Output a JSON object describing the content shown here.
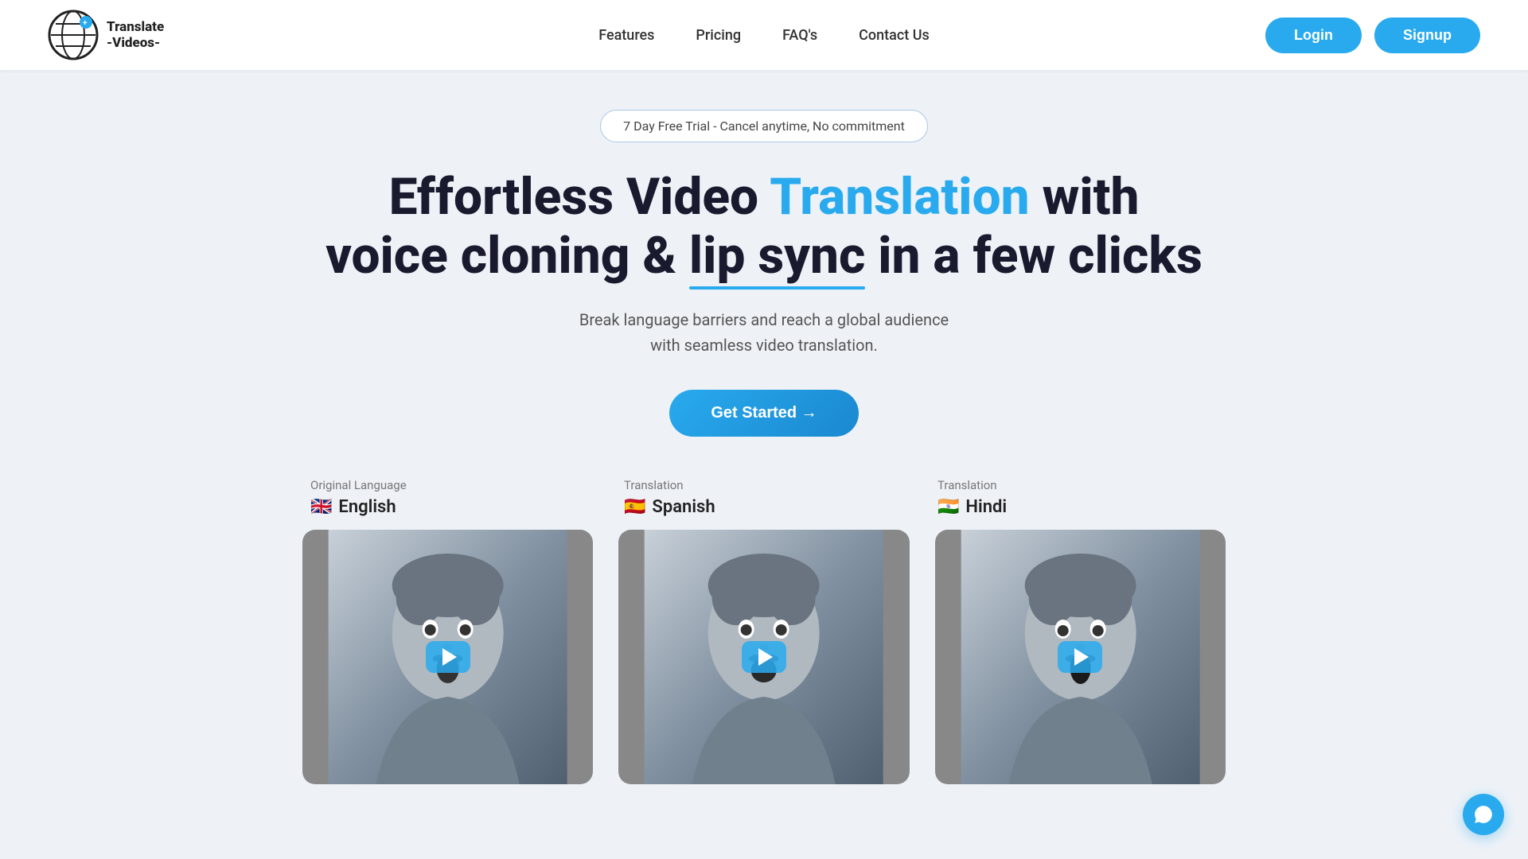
{
  "nav": {
    "logo_text": "Translate\n-Videos-",
    "links": [
      {
        "label": "Features",
        "id": "features"
      },
      {
        "label": "Pricing",
        "id": "pricing"
      },
      {
        "label": "FAQ's",
        "id": "faqs"
      },
      {
        "label": "Contact Us",
        "id": "contact"
      }
    ],
    "login_label": "Login",
    "signup_label": "Signup"
  },
  "hero": {
    "trial_badge": "7 Day Free Trial - Cancel anytime, No commitment",
    "title_part1": "Effortless Video ",
    "title_highlight": "Translation",
    "title_part2": " with",
    "title_line2_part1": "voice cloning & ",
    "title_underline": "lip sync",
    "title_line2_part2": " in a few clicks",
    "subtitle_line1": "Break language barriers and reach a global audience",
    "subtitle_line2": "with seamless video translation.",
    "cta_label": "Get Started →"
  },
  "videos": {
    "original": {
      "label": "Original Language",
      "flag": "🇬🇧",
      "language": "English"
    },
    "translation1": {
      "label": "Translation",
      "flag": "🇪🇸",
      "language": "Spanish"
    },
    "translation2": {
      "label": "Translation",
      "flag": "🇮🇳",
      "language": "Hindi"
    }
  },
  "colors": {
    "accent": "#29aaee",
    "dark": "#1a1a2e",
    "bg": "#eef2f7"
  }
}
